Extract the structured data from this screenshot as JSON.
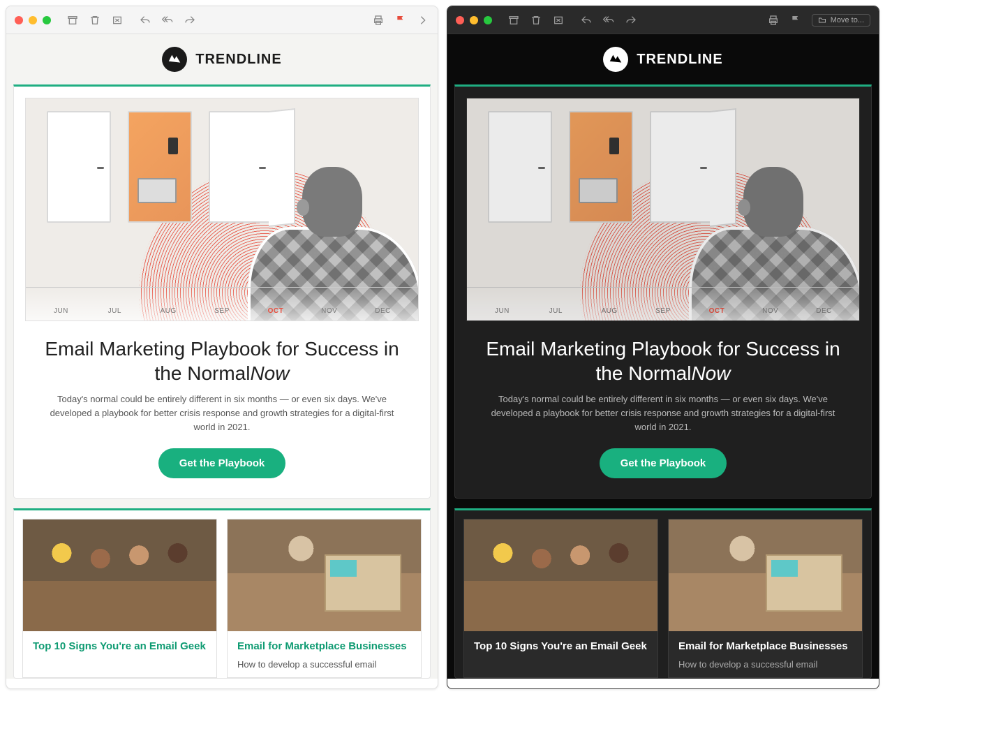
{
  "brand": {
    "name": "TRENDLINE"
  },
  "toolbar": {
    "move_to_label": "Move to..."
  },
  "hero": {
    "title_part1": "Email Marketing Playbook for Success in the Normal",
    "title_italic": "Now",
    "description": "Today's normal could be entirely different in six months — or even six days. We've developed a playbook for better crisis response and growth strategies for a digital-first world in 2021.",
    "cta_label": "Get the Playbook",
    "timeline": [
      "JUN",
      "JUL",
      "AUG",
      "SEP",
      "OCT",
      "NOV",
      "DEC"
    ],
    "timeline_highlight": "OCT"
  },
  "cards": [
    {
      "title": "Top 10 Signs You're an Email Geek",
      "description": ""
    },
    {
      "title": "Email for Marketplace Businesses",
      "description": "How to develop a successful email"
    }
  ],
  "colors": {
    "accent": "#19b07f",
    "accent_border": "#1fae82",
    "flag": "#e74c3c"
  }
}
